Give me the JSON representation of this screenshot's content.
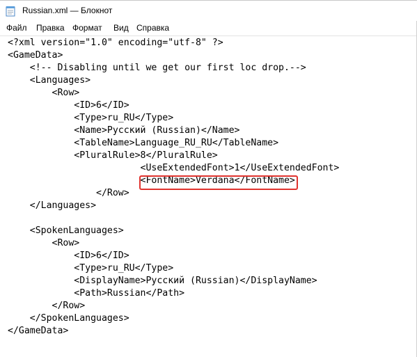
{
  "window": {
    "title": "Russian.xml — Блокнот"
  },
  "menu": {
    "file": "Файл",
    "edit": "Правка",
    "format": "Формат",
    "view": "Вид",
    "help": "Справка"
  },
  "colors": {
    "highlight": "#e0332e"
  },
  "icons": {
    "app": "notepad-icon"
  },
  "editor": {
    "lines": [
      "<?xml version=\"1.0\" encoding=\"utf-8\" ?>",
      "<GameData>",
      "    <!-- Disabling until we get our first loc drop.-->",
      "    <Languages>",
      "        <Row>",
      "            <ID>6</ID>",
      "            <Type>ru_RU</Type>",
      "            <Name>Русский (Russian)</Name>",
      "            <TableName>Language_RU_RU</TableName>",
      "            <PluralRule>8</PluralRule>",
      "                        <UseExtendedFont>1</UseExtendedFont>",
      "                        <FontName>Verdana</FontName>",
      "                </Row>",
      "    </Languages>",
      "",
      "    <SpokenLanguages>",
      "        <Row>",
      "            <ID>6</ID>",
      "            <Type>ru_RU</Type>",
      "            <DisplayName>Русский (Russian)</DisplayName>",
      "            <Path>Russian</Path>",
      "        </Row>",
      "    </SpokenLanguages>",
      "</GameData>"
    ]
  }
}
